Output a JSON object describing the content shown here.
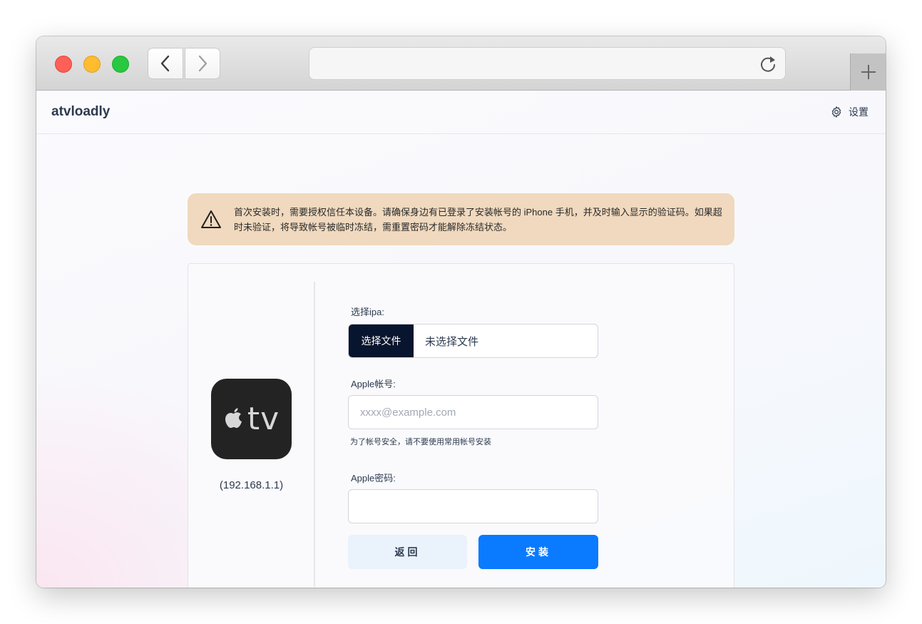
{
  "browser": {
    "url": "",
    "icons": {
      "back": "chevron-left-icon",
      "forward": "chevron-right-icon",
      "reload": "reload-icon",
      "new_tab": "plus-icon"
    }
  },
  "header": {
    "brand": "atvloadly",
    "settings_label": "设置",
    "settings_icon": "gear-icon"
  },
  "alert": {
    "icon": "warning-icon",
    "text": "首次安装时，需要授权信任本设备。请确保身边有已登录了安装帐号的 iPhone 手机，并及时输入显示的验证码。如果超时未验证，将导致帐号被临时冻结，需重置密码才能解除冻结状态。",
    "background": "#f0d9be"
  },
  "device": {
    "icon_label": "tv",
    "ip": "(192.168.1.1)"
  },
  "form": {
    "ipa_label": "选择ipa:",
    "file_button": "选择文件",
    "file_status": "未选择文件",
    "account_label": "Apple帐号:",
    "account_placeholder": "xxxx@example.com",
    "account_value": "",
    "account_hint": "为了帐号安全，请不要使用常用帐号安装",
    "password_label": "Apple密码:",
    "password_value": "",
    "back_button": "返回",
    "install_button": "安装"
  },
  "colors": {
    "accent": "#0a7aff",
    "file_button_bg": "#08152e",
    "back_button_bg": "#eaf2fc"
  }
}
